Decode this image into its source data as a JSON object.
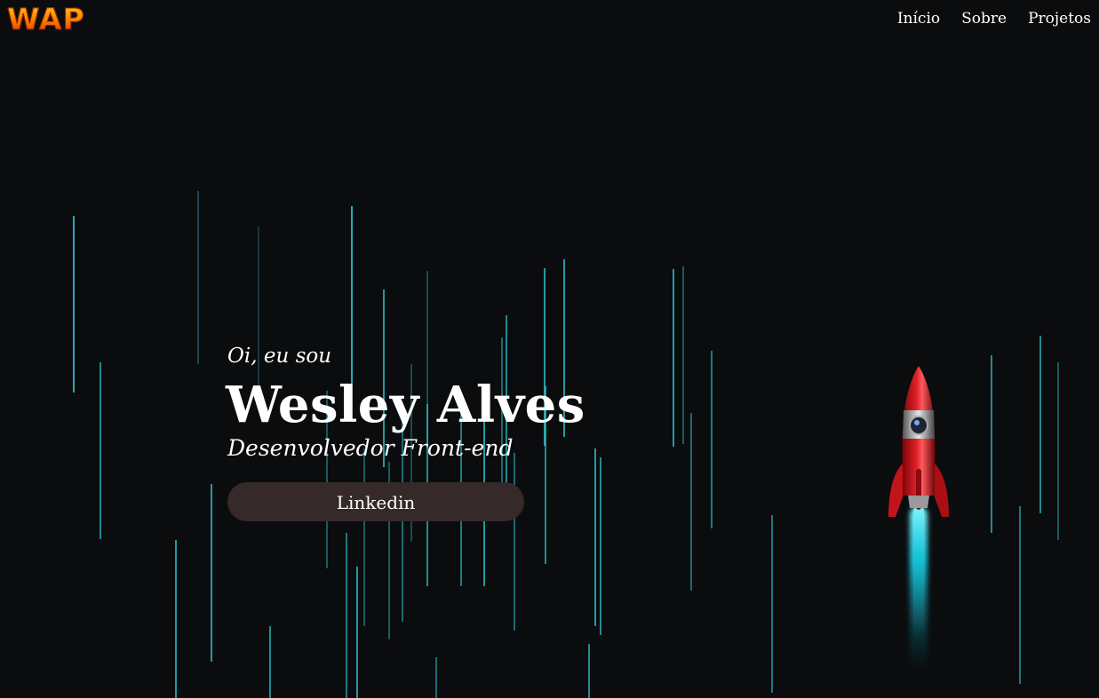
{
  "header": {
    "logo_text": "WAP",
    "nav": [
      {
        "label": "Início"
      },
      {
        "label": "Sobre"
      },
      {
        "label": "Projetos"
      }
    ]
  },
  "hero": {
    "greeting": "Oi, eu sou",
    "name": "Wesley Alves",
    "role": "Desenvolvedor Front-end",
    "button_label": "Linkedin"
  },
  "theme": {
    "background": "#0b0c0e",
    "rain_color": "#2fd2dc",
    "button_bg": "#362929",
    "rocket_body": "#d1141a",
    "rocket_flame": "#2fd2dc"
  },
  "icons": {
    "logo": "wap-logo",
    "rocket": "rocket-icon"
  }
}
